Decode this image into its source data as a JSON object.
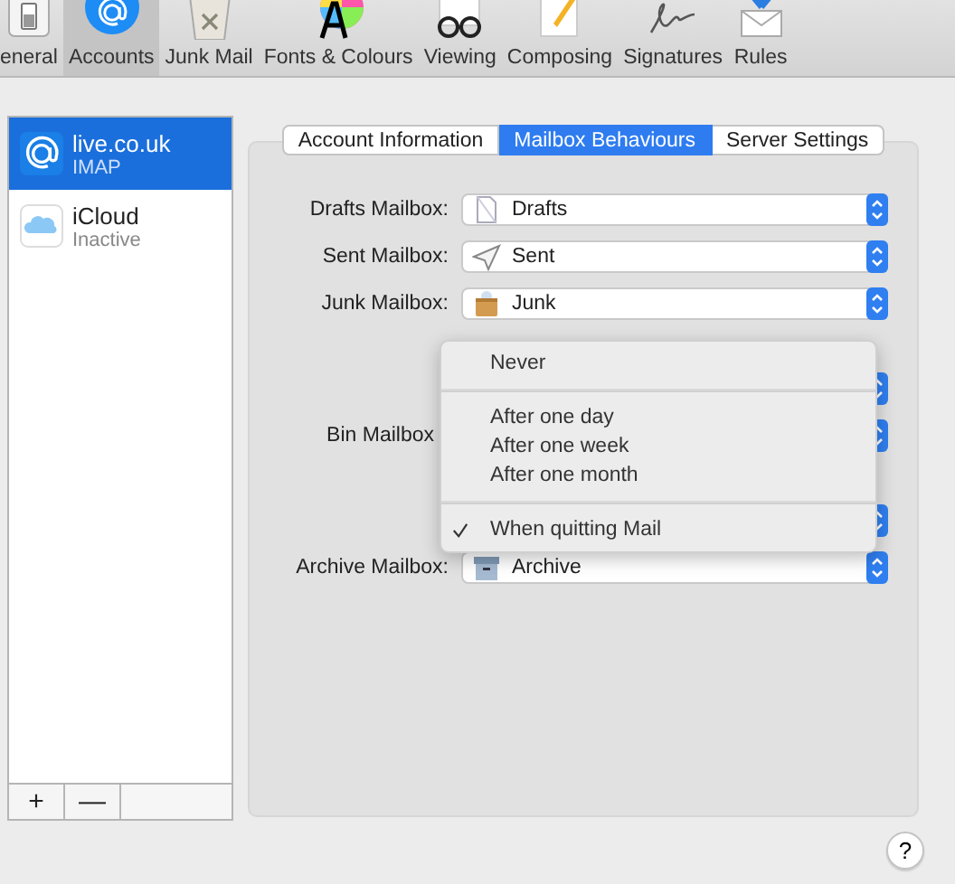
{
  "toolbar": [
    {
      "label": "eneral",
      "selected": false
    },
    {
      "label": "Accounts",
      "selected": true
    },
    {
      "label": "Junk Mail",
      "selected": false
    },
    {
      "label": "Fonts & Colours",
      "selected": false
    },
    {
      "label": "Viewing",
      "selected": false
    },
    {
      "label": "Composing",
      "selected": false
    },
    {
      "label": "Signatures",
      "selected": false
    },
    {
      "label": "Rules",
      "selected": false
    }
  ],
  "accounts": [
    {
      "name": "live.co.uk",
      "detail": "IMAP",
      "selected": true
    },
    {
      "name": "iCloud",
      "detail": "Inactive",
      "selected": false
    }
  ],
  "account_buttons": [
    "+",
    "—"
  ],
  "tabs": [
    {
      "label": "Account Information",
      "selected": false
    },
    {
      "label": "Mailbox Behaviours",
      "selected": true
    },
    {
      "label": "Server Settings",
      "selected": false
    }
  ],
  "rows": [
    {
      "label": "Drafts Mailbox:",
      "value": "Drafts"
    },
    {
      "label": "Sent Mailbox:",
      "value": "Sent"
    },
    {
      "label": "Junk Mailbox:",
      "value": "Junk"
    },
    {},
    {
      "label": "Bin Mailbox"
    },
    {},
    {
      "label": "Archive Mailbox:",
      "value": "Archive"
    }
  ],
  "menu": [
    {
      "label": "Never",
      "checked": false
    },
    {
      "kind": "separator"
    },
    {
      "label": "After one day",
      "checked": false
    },
    {
      "label": "After one week",
      "checked": false
    },
    {
      "label": "After one month",
      "checked": false
    },
    {
      "kind": "separator"
    },
    {
      "label": "When quitting Mail",
      "checked": true
    }
  ],
  "help": "?"
}
